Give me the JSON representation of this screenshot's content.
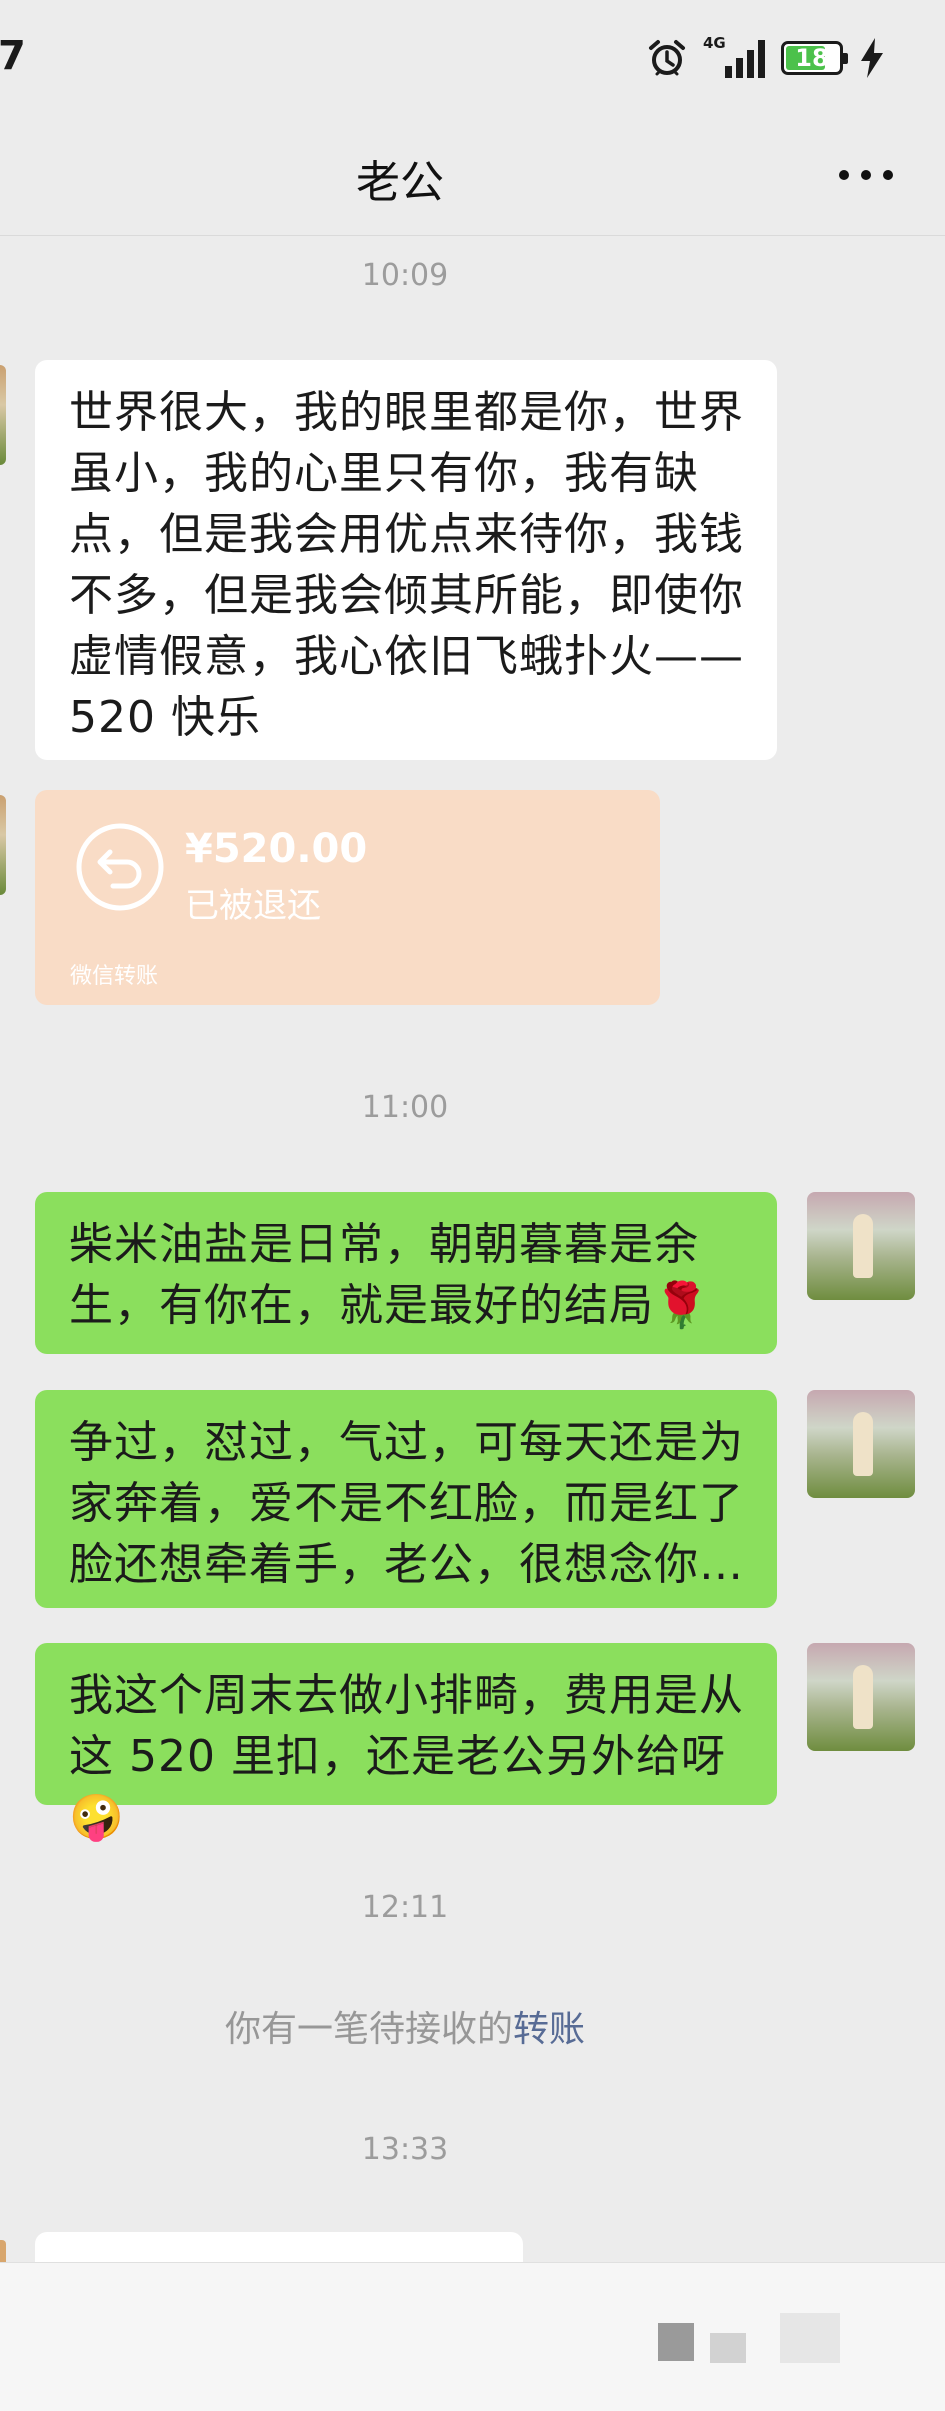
{
  "status_bar": {
    "time": "7",
    "network": "4G",
    "battery": "18"
  },
  "chat": {
    "title": "老公"
  },
  "messages": {
    "ts1": "10:09",
    "m1": "世界很大，我的眼里都是你，世界虽小，我的心里只有你，我有缺点，但是我会用优点来待你，我钱不多，但是我会倾其所能，即使你虚情假意，我心依旧飞蛾扑火——520 快乐",
    "transfer": {
      "amount": "¥520.00",
      "status": "已被退还",
      "source": "微信转账"
    },
    "ts2": "11:00",
    "m2": "柴米油盐是日常，朝朝暮暮是余生，有你在，就是最好的结局🌹",
    "m3": "争过，怼过，气过，可每天还是为家奔着，爱不是不红脸，而是红了脸还想牵着手，老公，很想念你…",
    "m4": "我这个周末去做小排畸，费用是从这 520 里扣，还是老公另外给呀🤪",
    "ts3": "12:11",
    "sys_text": "你有一笔待接收的",
    "sys_link": "转账",
    "ts4": "13:33"
  },
  "colors": {
    "background": "#ececec",
    "sent_bubble": "#8bdf5d",
    "received_bubble": "#ffffff",
    "transfer_card": "#f9dcc6",
    "link": "#576b95"
  }
}
